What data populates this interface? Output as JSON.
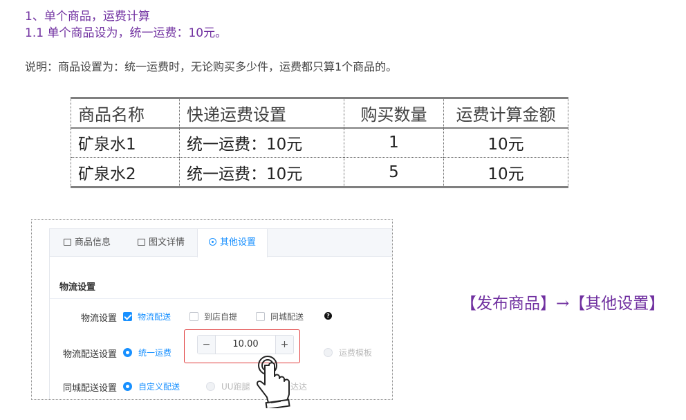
{
  "heading1": "1、单个商品，运费计算",
  "heading2": "1.1 单个商品设为，统一运费：10元。",
  "description": "说明：商品设置为：统一运费时，无论购买多少件，运费都只算1个商品的。",
  "table": {
    "headers": [
      "商品名称",
      "快递运费设置",
      "购买数量",
      "运费计算金额"
    ],
    "rows": [
      [
        "矿泉水1",
        "统一运费：10元",
        "1",
        "10元"
      ],
      [
        "矿泉水2",
        "统一运费：10元",
        "5",
        "10元"
      ]
    ]
  },
  "panel": {
    "tabs": [
      {
        "label": "商品信息",
        "icon": "list-icon"
      },
      {
        "label": "图文详情",
        "icon": "image-icon"
      },
      {
        "label": "其他设置",
        "icon": "eye-icon"
      }
    ],
    "section_title": "物流设置",
    "logistics": {
      "label": "物流设置",
      "options": [
        "物流配送",
        "到店自提",
        "同城配送"
      ],
      "checked": [
        true,
        false,
        false
      ]
    },
    "shipping_fee": {
      "label": "物流配送设置",
      "option_unified": "统一运费",
      "value": "10.00",
      "minus": "−",
      "plus": "+",
      "option_template": "运费模板"
    },
    "city_delivery": {
      "label": "同城配送设置",
      "options": [
        "自定义配送",
        "UU跑腿",
        "达达"
      ]
    }
  },
  "caption": "【发布商品】→【其他设置】",
  "colors": {
    "accent": "#7030a0",
    "link": "#1890ff",
    "highlight": "#e03b3b"
  }
}
